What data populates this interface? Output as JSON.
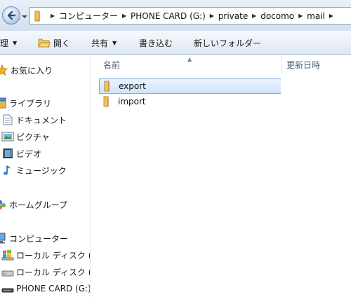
{
  "address": {
    "crumbs": [
      "コンピューター",
      "PHONE CARD (G:)",
      "private",
      "docomo",
      "mail"
    ]
  },
  "toolbar": {
    "organize_label": "理",
    "open_label": "開く",
    "share_label": "共有",
    "burn_label": "書き込む",
    "new_folder_label": "新しいフォルダー"
  },
  "nav": {
    "favorites": "お気に入り",
    "libraries": "ライブラリ",
    "documents": "ドキュメント",
    "pictures": "ピクチャ",
    "videos": "ビデオ",
    "music": "ミュージック",
    "homegroup": "ホームグループ",
    "computer": "コンピューター",
    "local_disk_1": "ローカル ディスク (",
    "local_disk_2": "ローカル ディスク (",
    "phone_card": "PHONE CARD (G:)"
  },
  "columns": {
    "name": "名前",
    "date": "更新日時"
  },
  "files": [
    {
      "name": "export",
      "selected": true
    },
    {
      "name": "import",
      "selected": false
    }
  ],
  "colors": {
    "selection": "#cfe4fb",
    "selection_border": "#84acdd",
    "folder": "#f3c55b",
    "toolbar_bg": "#dce7f3"
  }
}
